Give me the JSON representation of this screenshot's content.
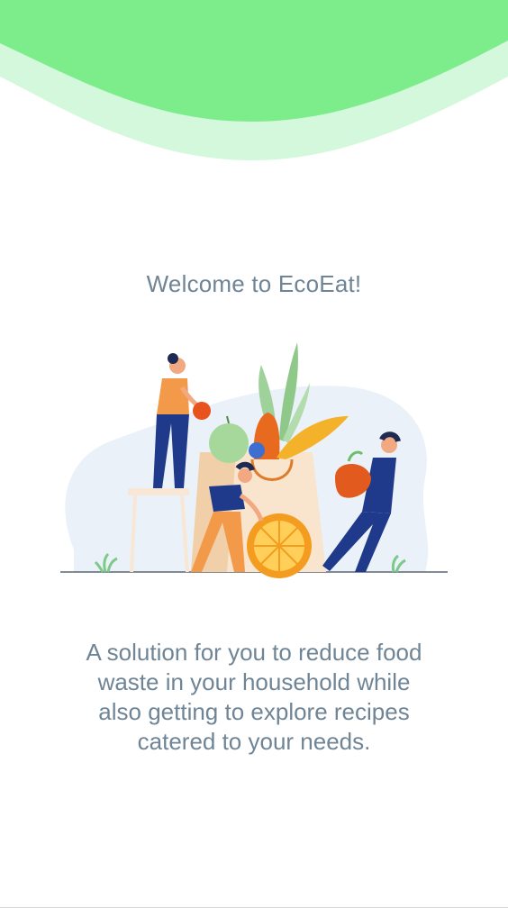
{
  "app": {
    "welcome_title": "Welcome to EcoEat!",
    "tagline": "A solution for you to reduce food waste in your household while also getting to explore recipes catered to your needs."
  },
  "colors": {
    "wave_primary": "#7ded8c",
    "wave_secondary": "#d4f8db",
    "text": "#6f8596",
    "accent_orange": "#f08b2c",
    "accent_navy": "#1f3a8a"
  },
  "illustration": {
    "subject": "people-with-grocery-bag-illustration"
  }
}
